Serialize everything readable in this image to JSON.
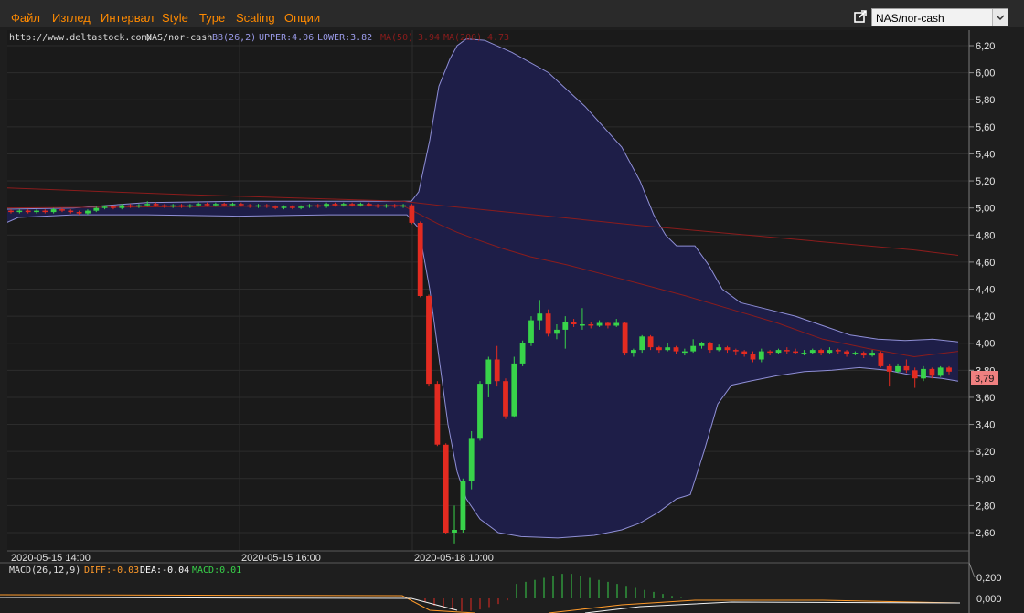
{
  "menu": {
    "items": [
      "Файл",
      "Изглед",
      "Интервал",
      "Style",
      "Type",
      "Scaling",
      "Опции"
    ]
  },
  "symbol_select": {
    "value": "NAS/nor-cash"
  },
  "header": {
    "url": "http://www.deltastock.com/",
    "symbol": "NAS/nor-cash",
    "bb": "BB(26,2)",
    "upper": "UPPER:4.06",
    "lower": "LOWER:3.82",
    "ma50": "MA(50)",
    "ma50_val": "3.94",
    "ma200": "MA(200)",
    "ma200_val": "4.73"
  },
  "macd_header": {
    "name": "MACD(26,12,9)",
    "diff": "DIFF:-0.03",
    "dea": "DEA:-0.04",
    "macd": "MACD:0.01"
  },
  "current_price": "3,79",
  "colors": {
    "up": "#38d34a",
    "down": "#e32b21",
    "band_fill": "#1e1e48",
    "band_line": "#8f8fd6",
    "ma_line": "#8b1c1c",
    "menu_text": "#ff8a00",
    "price_tag_bg": "#f08080"
  },
  "chart_data": {
    "type": "candlestick",
    "y_axis": {
      "min": 2.5,
      "max": 6.3,
      "ticks": [
        "2,60",
        "2,80",
        "3,00",
        "3,20",
        "3,40",
        "3,60",
        "3,80",
        "4,00",
        "4,20",
        "4,40",
        "4,60",
        "4,80",
        "5,00",
        "5,20",
        "5,40",
        "5,60",
        "5,80",
        "6,00",
        "6,20"
      ]
    },
    "x_ticks": [
      "2020-05-15 14:00",
      "2020-05-15 16:00",
      "2020-05-18 10:00"
    ],
    "candles": [
      [
        4.98,
        4.97,
        4.99,
        4.96
      ],
      [
        4.97,
        4.98,
        4.99,
        4.96
      ],
      [
        4.98,
        4.97,
        4.99,
        4.96
      ],
      [
        4.97,
        4.98,
        4.99,
        4.96
      ],
      [
        4.98,
        4.97,
        4.99,
        4.96
      ],
      [
        4.97,
        4.99,
        5.0,
        4.96
      ],
      [
        4.99,
        4.98,
        5.0,
        4.97
      ],
      [
        4.98,
        4.97,
        4.99,
        4.96
      ],
      [
        4.97,
        4.96,
        4.98,
        4.95
      ],
      [
        4.96,
        4.98,
        4.99,
        4.95
      ],
      [
        4.98,
        5.0,
        5.01,
        4.97
      ],
      [
        5.0,
        5.01,
        5.02,
        4.99
      ],
      [
        5.01,
        5.0,
        5.02,
        4.99
      ],
      [
        5.0,
        5.02,
        5.03,
        4.99
      ],
      [
        5.02,
        5.01,
        5.03,
        5.0
      ],
      [
        5.01,
        5.02,
        5.03,
        5.0
      ],
      [
        5.02,
        5.03,
        5.05,
        5.01
      ],
      [
        5.03,
        5.02,
        5.04,
        5.01
      ],
      [
        5.02,
        5.01,
        5.03,
        5.0
      ],
      [
        5.01,
        5.02,
        5.03,
        5.0
      ],
      [
        5.02,
        5.01,
        5.03,
        5.0
      ],
      [
        5.01,
        5.02,
        5.03,
        5.0
      ],
      [
        5.02,
        5.03,
        5.04,
        5.01
      ],
      [
        5.03,
        5.02,
        5.04,
        5.01
      ],
      [
        5.02,
        5.03,
        5.04,
        5.01
      ],
      [
        5.03,
        5.02,
        5.04,
        5.01
      ],
      [
        5.02,
        5.03,
        5.04,
        5.01
      ],
      [
        5.03,
        5.02,
        5.04,
        5.01
      ],
      [
        5.02,
        5.01,
        5.03,
        5.0
      ],
      [
        5.01,
        5.02,
        5.03,
        5.0
      ],
      [
        5.02,
        5.01,
        5.03,
        5.0
      ],
      [
        5.01,
        5.0,
        5.02,
        4.99
      ],
      [
        5.0,
        5.01,
        5.02,
        4.99
      ],
      [
        5.01,
        5.0,
        5.02,
        4.99
      ],
      [
        5.0,
        5.01,
        5.02,
        4.99
      ],
      [
        5.01,
        5.02,
        5.03,
        5.0
      ],
      [
        5.02,
        5.01,
        5.03,
        5.0
      ],
      [
        5.01,
        5.03,
        5.04,
        5.0
      ],
      [
        5.03,
        5.02,
        5.04,
        5.01
      ],
      [
        5.02,
        5.03,
        5.04,
        5.01
      ],
      [
        5.03,
        5.02,
        5.04,
        5.01
      ],
      [
        5.02,
        5.03,
        5.04,
        5.01
      ],
      [
        5.03,
        5.02,
        5.04,
        5.01
      ],
      [
        5.02,
        5.01,
        5.03,
        5.0
      ],
      [
        5.01,
        5.02,
        5.03,
        5.0
      ],
      [
        5.02,
        5.01,
        5.03,
        5.0
      ],
      [
        5.01,
        5.02,
        5.03,
        5.0
      ],
      [
        5.02,
        4.89,
        5.03,
        4.88
      ],
      [
        4.89,
        4.35,
        4.9,
        4.34
      ],
      [
        4.35,
        3.7,
        4.36,
        3.68
      ],
      [
        3.7,
        3.25,
        3.72,
        3.24
      ],
      [
        3.25,
        2.6,
        3.26,
        2.59
      ],
      [
        2.6,
        2.62,
        2.8,
        2.52
      ],
      [
        2.62,
        2.98,
        3.0,
        2.6
      ],
      [
        2.98,
        3.3,
        3.35,
        2.92
      ],
      [
        3.3,
        3.7,
        3.72,
        3.28
      ],
      [
        3.7,
        3.88,
        3.9,
        3.6
      ],
      [
        3.88,
        3.72,
        3.98,
        3.68
      ],
      [
        3.72,
        3.46,
        3.74,
        3.44
      ],
      [
        3.46,
        3.85,
        3.9,
        3.45
      ],
      [
        3.85,
        4.0,
        4.02,
        3.83
      ],
      [
        4.0,
        4.17,
        4.2,
        3.98
      ],
      [
        4.17,
        4.22,
        4.32,
        4.1
      ],
      [
        4.22,
        4.07,
        4.25,
        4.05
      ],
      [
        4.07,
        4.1,
        4.14,
        4.03
      ],
      [
        4.1,
        4.16,
        4.2,
        3.96
      ],
      [
        4.16,
        4.14,
        4.18,
        4.12
      ],
      [
        4.14,
        4.14,
        4.26,
        4.1
      ],
      [
        4.14,
        4.13,
        4.16,
        4.11
      ],
      [
        4.13,
        4.15,
        4.17,
        4.12
      ],
      [
        4.15,
        4.13,
        4.16,
        4.11
      ],
      [
        4.13,
        4.15,
        4.18,
        4.12
      ],
      [
        4.15,
        3.93,
        4.16,
        3.91
      ],
      [
        3.93,
        3.95,
        3.96,
        3.9
      ],
      [
        3.95,
        4.05,
        4.06,
        3.93
      ],
      [
        4.05,
        3.97,
        4.06,
        3.95
      ],
      [
        3.97,
        3.95,
        3.98,
        3.93
      ],
      [
        3.95,
        3.97,
        4.0,
        3.94
      ],
      [
        3.97,
        3.94,
        3.98,
        3.92
      ],
      [
        3.94,
        3.94,
        3.96,
        3.91
      ],
      [
        3.94,
        3.98,
        4.03,
        3.93
      ],
      [
        3.98,
        4.0,
        4.01,
        3.96
      ],
      [
        4.0,
        3.95,
        4.01,
        3.93
      ],
      [
        3.95,
        3.97,
        3.99,
        3.94
      ],
      [
        3.97,
        3.95,
        3.98,
        3.93
      ],
      [
        3.95,
        3.94,
        3.96,
        3.91
      ],
      [
        3.94,
        3.92,
        3.95,
        3.9
      ],
      [
        3.92,
        3.88,
        3.94,
        3.86
      ],
      [
        3.88,
        3.94,
        3.96,
        3.86
      ],
      [
        3.94,
        3.93,
        3.95,
        3.91
      ],
      [
        3.93,
        3.95,
        3.96,
        3.92
      ],
      [
        3.95,
        3.94,
        3.97,
        3.92
      ],
      [
        3.94,
        3.93,
        3.96,
        3.92
      ],
      [
        3.93,
        3.93,
        3.95,
        3.91
      ],
      [
        3.93,
        3.95,
        3.96,
        3.92
      ],
      [
        3.95,
        3.93,
        3.96,
        3.91
      ],
      [
        3.93,
        3.95,
        3.97,
        3.92
      ],
      [
        3.95,
        3.94,
        3.96,
        3.92
      ],
      [
        3.94,
        3.92,
        3.95,
        3.9
      ],
      [
        3.92,
        3.93,
        3.94,
        3.91
      ],
      [
        3.93,
        3.91,
        3.94,
        3.89
      ],
      [
        3.91,
        3.93,
        3.95,
        3.9
      ],
      [
        3.93,
        3.83,
        3.94,
        3.82
      ],
      [
        3.83,
        3.79,
        3.85,
        3.68
      ],
      [
        3.79,
        3.83,
        3.85,
        3.78
      ],
      [
        3.83,
        3.8,
        3.88,
        3.78
      ],
      [
        3.8,
        3.74,
        3.82,
        3.67
      ],
      [
        3.74,
        3.81,
        3.83,
        3.72
      ],
      [
        3.81,
        3.76,
        3.82,
        3.74
      ],
      [
        3.76,
        3.82,
        3.83,
        3.75
      ],
      [
        3.82,
        3.79,
        3.83,
        3.77
      ]
    ],
    "bb_upper": [
      [
        0,
        4.99
      ],
      [
        80,
        5.0
      ],
      [
        160,
        5.04
      ],
      [
        260,
        5.05
      ],
      [
        360,
        5.05
      ],
      [
        450,
        5.05
      ],
      [
        458,
        5.12
      ],
      [
        470,
        5.5
      ],
      [
        480,
        5.9
      ],
      [
        492,
        6.1
      ],
      [
        500,
        6.2
      ],
      [
        510,
        6.25
      ],
      [
        530,
        6.24
      ],
      [
        560,
        6.15
      ],
      [
        600,
        6.0
      ],
      [
        640,
        5.75
      ],
      [
        680,
        5.45
      ],
      [
        700,
        5.2
      ],
      [
        715,
        4.95
      ],
      [
        728,
        4.8
      ],
      [
        740,
        4.72
      ],
      [
        760,
        4.72
      ],
      [
        775,
        4.58
      ],
      [
        790,
        4.4
      ],
      [
        810,
        4.3
      ],
      [
        840,
        4.25
      ],
      [
        870,
        4.2
      ],
      [
        900,
        4.13
      ],
      [
        930,
        4.06
      ],
      [
        960,
        4.03
      ],
      [
        990,
        4.02
      ],
      [
        1020,
        4.03
      ],
      [
        1048,
        4.01
      ]
    ],
    "bb_lower": [
      [
        0,
        4.87
      ],
      [
        20,
        4.93
      ],
      [
        80,
        4.95
      ],
      [
        160,
        4.95
      ],
      [
        260,
        4.94
      ],
      [
        360,
        4.95
      ],
      [
        445,
        4.95
      ],
      [
        458,
        4.85
      ],
      [
        470,
        4.4
      ],
      [
        480,
        3.9
      ],
      [
        490,
        3.4
      ],
      [
        500,
        3.05
      ],
      [
        510,
        2.85
      ],
      [
        525,
        2.7
      ],
      [
        545,
        2.6
      ],
      [
        570,
        2.57
      ],
      [
        610,
        2.56
      ],
      [
        650,
        2.58
      ],
      [
        680,
        2.62
      ],
      [
        700,
        2.67
      ],
      [
        720,
        2.75
      ],
      [
        740,
        2.85
      ],
      [
        755,
        2.88
      ],
      [
        770,
        3.2
      ],
      [
        785,
        3.55
      ],
      [
        800,
        3.69
      ],
      [
        820,
        3.72
      ],
      [
        850,
        3.76
      ],
      [
        880,
        3.79
      ],
      [
        910,
        3.8
      ],
      [
        940,
        3.82
      ],
      [
        970,
        3.8
      ],
      [
        1000,
        3.76
      ],
      [
        1030,
        3.74
      ],
      [
        1048,
        3.72
      ]
    ],
    "ma50": [
      [
        0,
        5.0
      ],
      [
        200,
        5.01
      ],
      [
        440,
        5.02
      ],
      [
        460,
        4.95
      ],
      [
        480,
        4.88
      ],
      [
        500,
        4.82
      ],
      [
        520,
        4.77
      ],
      [
        550,
        4.7
      ],
      [
        580,
        4.64
      ],
      [
        620,
        4.58
      ],
      [
        660,
        4.51
      ],
      [
        700,
        4.44
      ],
      [
        750,
        4.35
      ],
      [
        800,
        4.25
      ],
      [
        850,
        4.15
      ],
      [
        900,
        4.03
      ],
      [
        950,
        3.96
      ],
      [
        1000,
        3.9
      ],
      [
        1048,
        3.94
      ]
    ],
    "ma200": [
      [
        0,
        5.15
      ],
      [
        200,
        5.1
      ],
      [
        440,
        5.05
      ],
      [
        480,
        5.02
      ],
      [
        600,
        4.94
      ],
      [
        700,
        4.87
      ],
      [
        800,
        4.81
      ],
      [
        900,
        4.75
      ],
      [
        1000,
        4.69
      ],
      [
        1048,
        4.65
      ]
    ],
    "macd_axis": [
      "0,200",
      "0,000"
    ]
  }
}
